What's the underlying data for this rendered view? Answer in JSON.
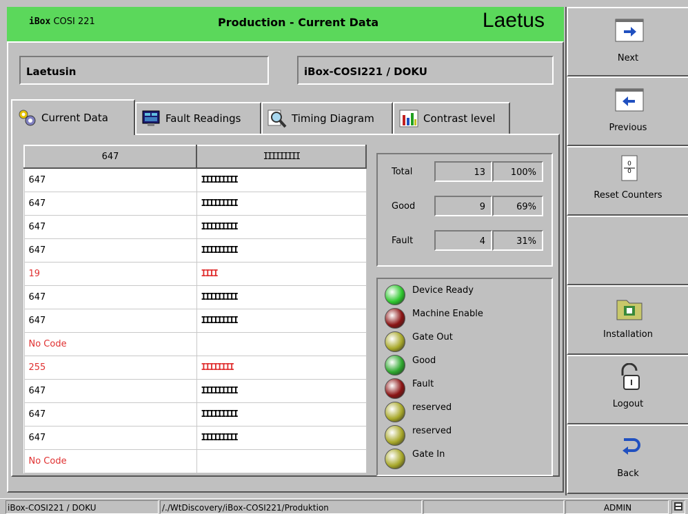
{
  "header": {
    "app_name_bold": "iBox",
    "app_name_rest": "COSI 221",
    "title": "Production - Current Data",
    "brand": "Laetus"
  },
  "fields": {
    "name": "Laetusin",
    "device": "iBox-COSI221 / DOKU"
  },
  "tabs": [
    {
      "label": "Current Data",
      "icon": "gears-icon",
      "active": true
    },
    {
      "label": "Fault Readings",
      "icon": "monitor-icon",
      "active": false
    },
    {
      "label": "Timing Diagram",
      "icon": "magnifier-icon",
      "active": false
    },
    {
      "label": "Contrast level",
      "icon": "bar-chart-icon",
      "active": false
    }
  ],
  "table": {
    "headers": [
      "647",
      "IIIIIIIII"
    ],
    "rows": [
      {
        "code": "647",
        "bars": "IIIIIIIII",
        "fault": false
      },
      {
        "code": "647",
        "bars": "IIIIIIIII",
        "fault": false
      },
      {
        "code": "647",
        "bars": "IIIIIIIII",
        "fault": false
      },
      {
        "code": "647",
        "bars": "IIIIIIIII",
        "fault": false
      },
      {
        "code": "19",
        "bars": "IIII",
        "fault": true
      },
      {
        "code": "647",
        "bars": "IIIIIIIII",
        "fault": false
      },
      {
        "code": "647",
        "bars": "IIIIIIIII",
        "fault": false
      },
      {
        "code": "No Code",
        "bars": "",
        "fault": true
      },
      {
        "code": "255",
        "bars": "IIIIIIII",
        "fault": true
      },
      {
        "code": "647",
        "bars": "IIIIIIIII",
        "fault": false
      },
      {
        "code": "647",
        "bars": "IIIIIIIII",
        "fault": false
      },
      {
        "code": "647",
        "bars": "IIIIIIIII",
        "fault": false
      },
      {
        "code": "No Code",
        "bars": "",
        "fault": true
      }
    ]
  },
  "counters": [
    {
      "label": "Total",
      "value": "13",
      "percent": "100%"
    },
    {
      "label": "Good",
      "value": "9",
      "percent": "69%"
    },
    {
      "label": "Fault",
      "value": "4",
      "percent": "31%"
    }
  ],
  "lamps": [
    {
      "label": "Device Ready",
      "color": "#2fc82f"
    },
    {
      "label": "Machine Enable",
      "color": "#8b1414"
    },
    {
      "label": "Gate Out",
      "color": "#a8a82a"
    },
    {
      "label": "Good",
      "color": "#2fa82f"
    },
    {
      "label": "Fault",
      "color": "#8b1414"
    },
    {
      "label": "reserved",
      "color": "#a8a82a"
    },
    {
      "label": "reserved",
      "color": "#a8a82a"
    },
    {
      "label": "Gate In",
      "color": "#a8a82a"
    }
  ],
  "sidebar": [
    {
      "label": "Next",
      "icon": "next-arrow-icon"
    },
    {
      "label": "Previous",
      "icon": "previous-arrow-icon"
    },
    {
      "label": "Reset Counters",
      "icon": "reset-counter-icon"
    },
    {
      "label": "",
      "icon": ""
    },
    {
      "label": "Installation",
      "icon": "installation-folder-icon"
    },
    {
      "label": "Logout",
      "icon": "padlock-icon"
    },
    {
      "label": "Back",
      "icon": "back-arrow-icon"
    }
  ],
  "statusbar": {
    "device": "iBox-COSI221 / DOKU",
    "path": "/./WtDiscovery/iBox-COSI221/Produktion",
    "empty": "",
    "user": "ADMIN",
    "icon": "keyboard-icon"
  },
  "colors": {
    "header_bg": "#5bd85b",
    "fault_text": "#e03030",
    "panel_bg": "#c0c0c0"
  }
}
